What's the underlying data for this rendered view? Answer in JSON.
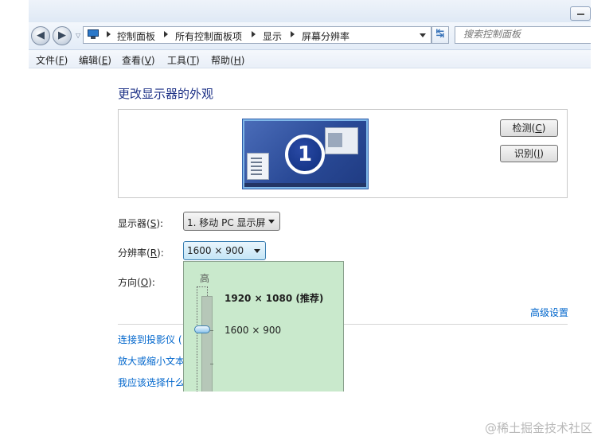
{
  "window": {
    "breadcrumbs": [
      "控制面板",
      "所有控制面板项",
      "显示",
      "屏幕分辨率"
    ],
    "search_placeholder": "搜索控制面板",
    "menu": [
      {
        "label": "文件",
        "key": "F"
      },
      {
        "label": "编辑",
        "key": "E"
      },
      {
        "label": "查看",
        "key": "V"
      },
      {
        "label": "工具",
        "key": "T"
      },
      {
        "label": "帮助",
        "key": "H"
      }
    ]
  },
  "content": {
    "title": "更改显示器的外观",
    "monitor_number": "1",
    "detect_button": {
      "label": "检测",
      "key": "C"
    },
    "identify_button": {
      "label": "识别",
      "key": "I"
    },
    "display_label": {
      "label": "显示器",
      "key": "S"
    },
    "display_value": "1. 移动 PC 显示屏",
    "resolution_label": {
      "label": "分辨率",
      "key": "R"
    },
    "resolution_value": "1600 × 900",
    "orientation_label": {
      "label": "方向",
      "key": "O"
    },
    "advanced_link": "高级设置",
    "links": [
      "连接到投影仪 (",
      "放大或缩小文本",
      "我应该选择什么"
    ]
  },
  "resolution_dropdown": {
    "high_label": "高",
    "options": [
      "1920 × 1080 (推荐)",
      "1600 × 900"
    ],
    "selected": "1600 × 900"
  },
  "watermark": "@稀土掘金技术社区"
}
